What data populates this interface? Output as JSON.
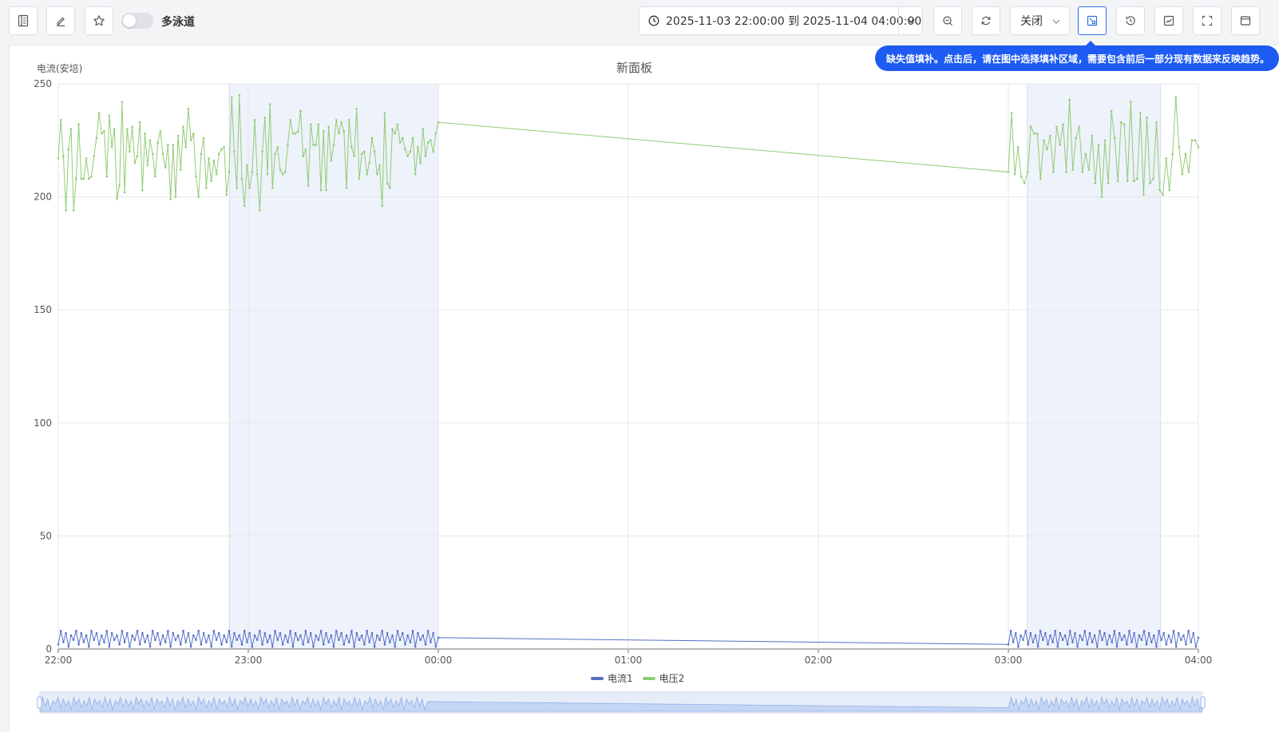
{
  "toolbar": {
    "multi_lane_label": "多泳道",
    "time_range_text": "2025-11-03 22:00:00 到 2025-11-04 04:00:00",
    "refresh_value": "关闭"
  },
  "tooltip": {
    "text": "缺失值填补。点击后，请在图中选择填补区域，需要包含前后一部分现有数据来反映趋势。"
  },
  "icons": [
    "sidebar-toggle-icon",
    "edit-icon",
    "star-icon",
    "clock-icon",
    "chevron-down-icon",
    "zoom-out-icon",
    "refresh-icon",
    "missing-value-fill-icon",
    "history-icon",
    "chart-edit-icon",
    "fullscreen-icon",
    "window-icon"
  ],
  "colors": {
    "accent": "#2f6fe8",
    "tooltip_bg": "#1d5bf2",
    "series1": "#5470c6",
    "series2": "#91cc75",
    "selection_band": "#eef2fb"
  },
  "chart_data": {
    "type": "line",
    "title": "新面板",
    "ylabel": "电流(安培)",
    "xlabel": "",
    "ylim": [
      0,
      250
    ],
    "yticks": [
      "0",
      "50",
      "100",
      "150",
      "200",
      "250"
    ],
    "xticks": [
      "22:00",
      "23:00",
      "00:00",
      "01:00",
      "02:00",
      "03:00",
      "04:00"
    ],
    "x_range_hours": [
      0,
      6
    ],
    "grid": true,
    "legend": "bottom-center",
    "highlighted_ranges_hours": [
      [
        0.9,
        2.0
      ],
      [
        5.1,
        5.8
      ]
    ],
    "series": [
      {
        "name": "电流1",
        "color": "#5470c6",
        "segments": [
          {
            "x_start": 0.0,
            "x_end": 2.0,
            "values": [
              2,
              8,
              3,
              7,
              1,
              6,
              4,
              8,
              2,
              7,
              3,
              6,
              1,
              8,
              4,
              7,
              2,
              6,
              3,
              8,
              1,
              7,
              4,
              6,
              2,
              8,
              3,
              7,
              1,
              6,
              4,
              8,
              2,
              7,
              3,
              6,
              1,
              8,
              4,
              7,
              2,
              6,
              3,
              8,
              1,
              7,
              4,
              6,
              2,
              8,
              3,
              7,
              1,
              6,
              4,
              8,
              2,
              7,
              3,
              6,
              1,
              8,
              4,
              7,
              2,
              6,
              3,
              8,
              1,
              7,
              4,
              6,
              2,
              8,
              3,
              7,
              1,
              6,
              4,
              8,
              2,
              7,
              3,
              6,
              1,
              8,
              4,
              7,
              2,
              6,
              3,
              8,
              1,
              7,
              4,
              6,
              2,
              8,
              3,
              7,
              1,
              6,
              4,
              8,
              2,
              7,
              3,
              6,
              1,
              8,
              4,
              7,
              2,
              6,
              3,
              8,
              1,
              7,
              4,
              6,
              2,
              8,
              3,
              7,
              1,
              6,
              4,
              8,
              2,
              7,
              3,
              6,
              1,
              8,
              4,
              7,
              2,
              6,
              3,
              8,
              1,
              7,
              4,
              6,
              2,
              8,
              3,
              7,
              1,
              5
            ]
          },
          {
            "x_start": 2.0,
            "x_end": 5.0,
            "values": [
              5.5,
              2
            ]
          },
          {
            "x_start": 5.0,
            "x_end": 6.0,
            "values": [
              2,
              8,
              3,
              7,
              1,
              6,
              4,
              8,
              2,
              7,
              3,
              6,
              1,
              8,
              4,
              7,
              2,
              6,
              3,
              8,
              1,
              7,
              4,
              6,
              2,
              8,
              3,
              7,
              1,
              6,
              4,
              8,
              2,
              7,
              3,
              6,
              1,
              8,
              4,
              7,
              2,
              6,
              3,
              8,
              1,
              7,
              4,
              6,
              2,
              8,
              3,
              7,
              1,
              6,
              4,
              8,
              2,
              7,
              3,
              6,
              1,
              8,
              4,
              7,
              2,
              6,
              3,
              8,
              1,
              7,
              4,
              6,
              2,
              8,
              3,
              7,
              1,
              5
            ]
          }
        ]
      },
      {
        "name": "电压2",
        "color": "#91cc75",
        "segments": [
          {
            "x_start": 0.0,
            "x_end": 2.0,
            "values": [
              217,
              234,
              218,
              194,
              221,
              230,
              194,
              208,
              232,
              208,
              208,
              217,
              208,
              209,
              218,
              226,
              237,
              228,
              229,
              209,
              236,
              222,
              230,
              199,
              205,
              242,
              202,
              230,
              220,
              231,
              215,
              218,
              233,
              203,
              228,
              214,
              225,
              219,
              209,
              224,
              229,
              219,
              213,
              223,
              199,
              223,
              200,
              227,
              212,
              231,
              222,
              239,
              225,
              228,
              209,
              200,
              219,
              226,
              204,
              217,
              207,
              216,
              210,
              219,
              221,
              222,
              201,
              211,
              244,
              220,
              204,
              245,
              208,
              196,
              214,
              204,
              211,
              234,
              210,
              194,
              220,
              235,
              210,
              241,
              204,
              219,
              222,
              212,
              210,
              211,
              223,
              234,
              228,
              228,
              229,
              238,
              218,
              221,
              205,
              232,
              223,
              223,
              232,
              203,
              229,
              203,
              231,
              216,
              223,
              234,
              228,
              233,
              229,
              204,
              234,
              222,
              218,
              239,
              208,
              219,
              220,
              210,
              215,
              226,
              220,
              210,
              214,
              196,
              237,
              206,
              204,
              230,
              228,
              232,
              224,
              226,
              221,
              218,
              220,
              226,
              210,
              222,
              215,
              230,
              218,
              224,
              225,
              220,
              228,
              233
            ]
          },
          {
            "x_start": 2.0,
            "x_end": 5.0,
            "values": [
              233,
              211
            ]
          },
          {
            "x_start": 5.0,
            "x_end": 6.0,
            "values": [
              211,
              237,
              210,
              222,
              209,
              206,
              211,
              231,
              228,
              228,
              208,
              225,
              221,
              227,
              211,
              231,
              223,
              232,
              211,
              243,
              212,
              226,
              231,
              211,
              219,
              212,
              227,
              206,
              223,
              200,
              225,
              206,
              238,
              226,
              207,
              233,
              232,
              207,
              242,
              207,
              208,
              237,
              201,
              235,
              206,
              208,
              233,
              203,
              201,
              217,
              203,
              219,
              244,
              222,
              210,
              219,
              211,
              225,
              225,
              222
            ]
          }
        ]
      }
    ]
  }
}
